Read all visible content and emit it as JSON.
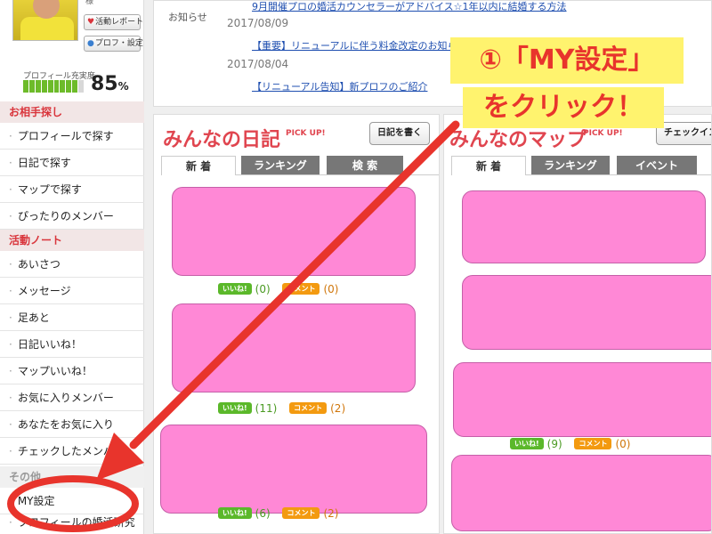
{
  "profile": {
    "top_name": "様",
    "report_button": "活動レポート",
    "profile_settings_button": "プロフ・設定",
    "completion_label": "プロフィール充実度",
    "completion_percent": 85,
    "completion_unit": "%",
    "colors": {
      "bar_on": "#6dbb2a",
      "bar_off": "#d8d8d8"
    }
  },
  "sidebar": {
    "sections": [
      {
        "title": "お相手探し",
        "items": [
          "プロフィールで探す",
          "日記で探す",
          "マップで探す",
          "ぴったりのメンバー"
        ]
      },
      {
        "title": "活動ノート",
        "items": [
          "あいさつ",
          "メッセージ",
          "足あと",
          "日記いいね！",
          "マップいいね！",
          "お気に入りメンバー",
          "あなたをお気に入り",
          "チェックしたメンバー"
        ]
      },
      {
        "title": "その他",
        "items": [
          "MY設定",
          "プロフィールの婚活研究"
        ]
      }
    ]
  },
  "notice": {
    "label": "お知らせ",
    "items": [
      {
        "date": "",
        "text": "9月開催プロの婚活カウンセラーがアドバイス☆1年以内に結婚する方法"
      },
      {
        "date": "2017/08/09",
        "text": "【重要】リニューアルに伴う料金改定のお知らせ"
      },
      {
        "date": "2017/08/04",
        "text": "【リニューアル告知】新プロフのご紹介"
      }
    ]
  },
  "diary": {
    "title": "みんなの日記",
    "pickup": "PICK UP!",
    "write_button": "日記を書く",
    "tabs": [
      "新 着",
      "ランキング",
      "検 索"
    ],
    "posts": [
      {
        "like_label": "いいね!",
        "likes": "(0)",
        "comment_label": "コメント",
        "comments": "(0)"
      },
      {
        "like_label": "いいね!",
        "likes": "(11)",
        "comment_label": "コメント",
        "comments": "(2)"
      },
      {
        "like_label": "いいね!",
        "likes": "(6)",
        "comment_label": "コメント",
        "comments": "(2)"
      }
    ]
  },
  "map": {
    "title": "みんなのマップ",
    "pickup": "PICK UP!",
    "checkin_button": "チェックイン",
    "tabs": [
      "新 着",
      "ランキング",
      "イベント"
    ],
    "posts": [
      {
        "like_label": "いいね!",
        "likes": "(9)",
        "comment_label": "コメント",
        "comments": "(0)"
      }
    ]
  },
  "annotation": {
    "line1": "①「MY設定」",
    "line2": "をクリック！",
    "colors": {
      "text": "#e8342c",
      "highlight": "#fff36e",
      "arrow": "#e8342c"
    }
  }
}
